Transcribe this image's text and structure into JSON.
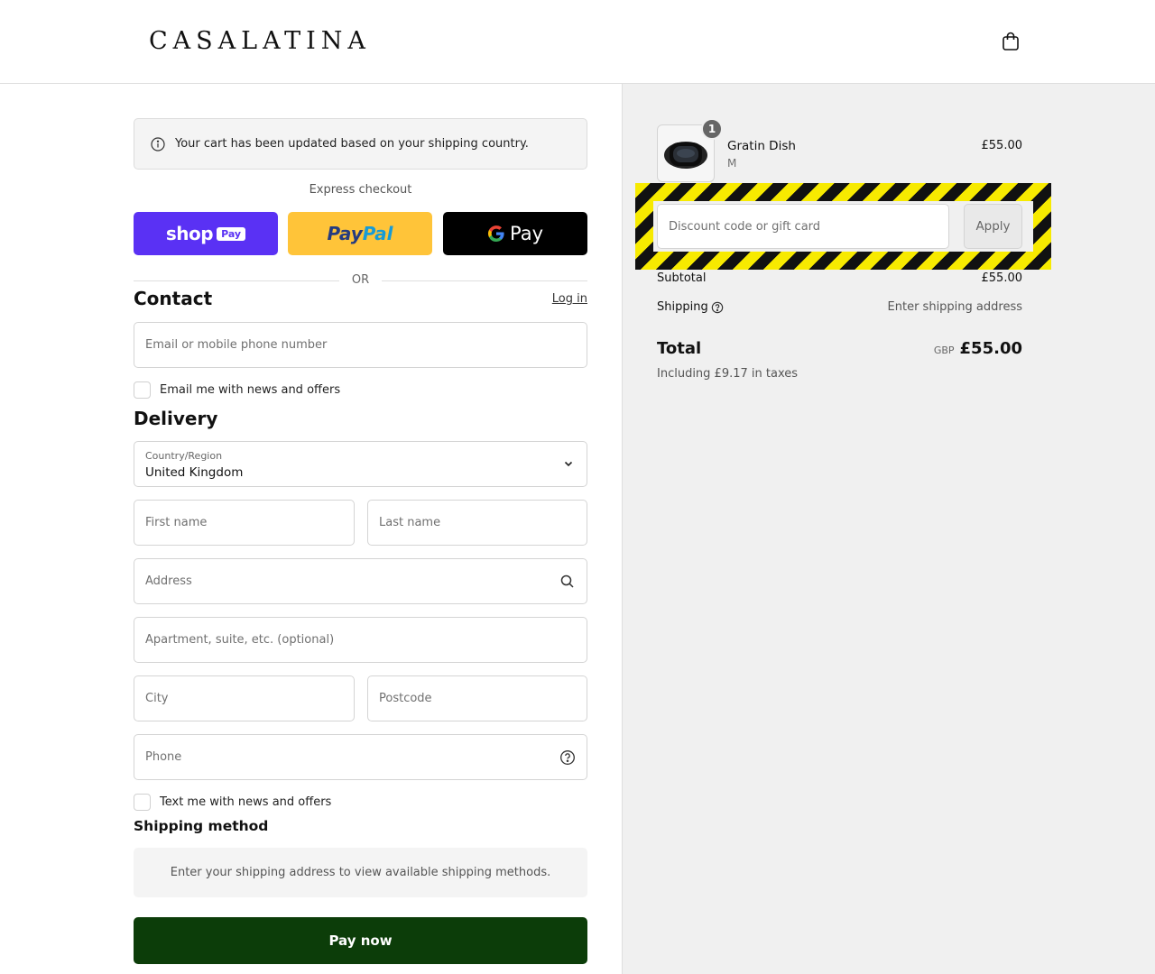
{
  "header": {
    "brand": "CASALATINA",
    "cart_icon": "shopping-bag-icon"
  },
  "notice": {
    "text": "Your cart has been updated based on your shipping country.",
    "icon": "info-icon"
  },
  "express": {
    "label": "Express checkout",
    "shop_pay": {
      "word": "shop",
      "badge": "Pay"
    },
    "paypal": {
      "part1": "Pay",
      "part2": "Pal"
    },
    "gpay": {
      "letter": "G",
      "word": "Pay"
    },
    "or": "OR"
  },
  "contact": {
    "title": "Contact",
    "login": "Log in",
    "email_placeholder": "Email or mobile phone number",
    "news_label": "Email me with news and offers"
  },
  "delivery": {
    "title": "Delivery",
    "country_label": "Country/Region",
    "country_value": "United Kingdom",
    "first_name": "First name",
    "last_name": "Last name",
    "address": "Address",
    "apartment": "Apartment, suite, etc. (optional)",
    "city": "City",
    "postcode": "Postcode",
    "phone": "Phone",
    "sms_label": "Text me with news and offers"
  },
  "shipping_method": {
    "title": "Shipping method",
    "info": "Enter your shipping address to view available shipping methods."
  },
  "pay_now": "Pay now",
  "summary": {
    "product": {
      "name": "Gratin Dish",
      "variant": "M",
      "price": "£55.00",
      "quantity": "1"
    },
    "discount_placeholder": "Discount code or gift card",
    "apply": "Apply",
    "subtotal_label": "Subtotal",
    "subtotal_value": "£55.00",
    "shipping_label": "Shipping",
    "shipping_value": "Enter shipping address",
    "total_label": "Total",
    "currency": "GBP",
    "total_value": "£55.00",
    "taxes": "Including £9.17 in taxes"
  },
  "colors": {
    "shop_pay": "#5a31f4",
    "paypal": "#ffc439",
    "gpay": "#000000",
    "pay_now": "#0c3d09"
  }
}
